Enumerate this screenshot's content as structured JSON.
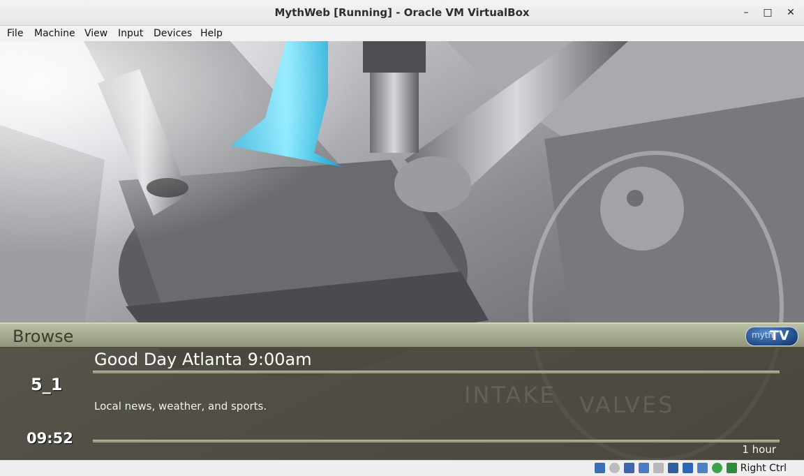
{
  "window": {
    "title": "MythWeb [Running] - Oracle VM VirtualBox"
  },
  "titlebar_buttons": {
    "minimize": "–",
    "maximize": "□",
    "close": "✕"
  },
  "menu": [
    "File",
    "Machine",
    "View",
    "Input",
    "Devices",
    "Help"
  ],
  "browse": {
    "heading": "Browse",
    "logo_small": "myth",
    "logo_big": "TV",
    "program_title": "Good Day Atlanta 9:00am",
    "channel": "5_1",
    "description": "Local news, weather, and sports.",
    "clock": "09:52",
    "duration": "1 hour"
  },
  "background_text": {
    "line1": "INTAKE",
    "line2": "VALVES"
  },
  "statusbar": {
    "icons": [
      "hard-disk-icon",
      "optical-drive-icon",
      "audio-icon",
      "network-icon",
      "usb-icon",
      "shared-folders-icon",
      "display-icon",
      "recording-icon",
      "cpu-icon",
      "mouse-integration-icon",
      "host-key-icon"
    ],
    "host_key": "Right Ctrl"
  }
}
